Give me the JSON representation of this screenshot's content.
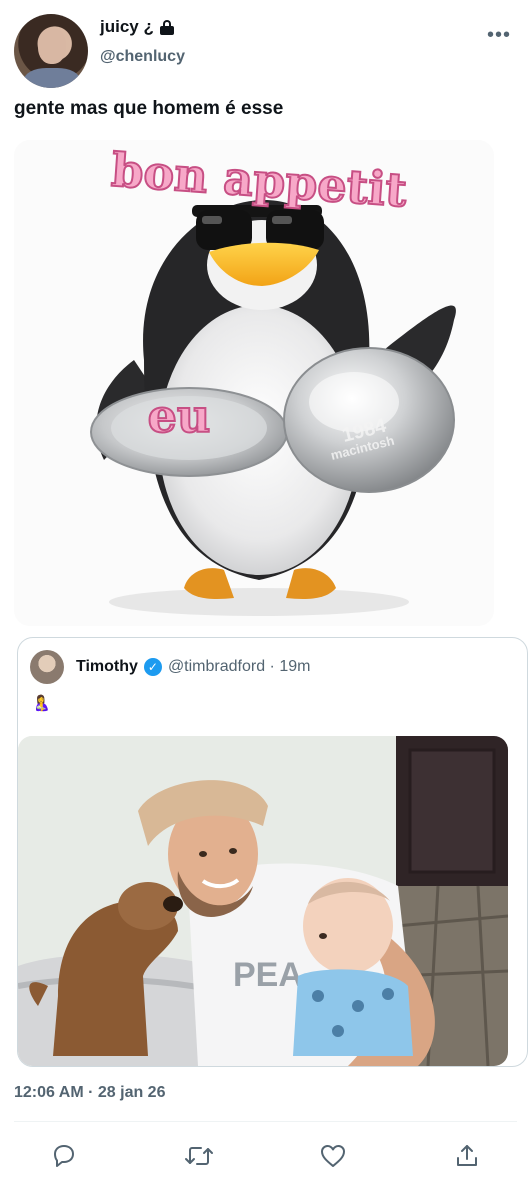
{
  "tweet": {
    "display_name": "juicy ¿",
    "handle": "@chenlucy",
    "text": "gente mas que homem é esse",
    "timestamp": "12:06 AM · 28 jan 26"
  },
  "meme": {
    "caption_top": "bon appetit",
    "caption_plate": "eu",
    "lid_text_line1": "1984",
    "lid_text_line2": "macintosh"
  },
  "quoted_tweet": {
    "display_name": "Timothy",
    "handle": "@timbradford · 19m",
    "text": "🤱",
    "photo_shirt_text": "PEA"
  },
  "icons": {
    "lock": "lock-icon",
    "more": "more-icon",
    "verified": "verified-icon",
    "reply": "reply-icon",
    "retweet": "retweet-icon",
    "like": "like-icon",
    "share": "share-icon"
  },
  "colors": {
    "text_primary": "#0f1419",
    "text_secondary": "#536471",
    "verified_blue": "#1d9bf0",
    "border": "#cfd9de",
    "caption_pink": "#f7a8c8"
  }
}
